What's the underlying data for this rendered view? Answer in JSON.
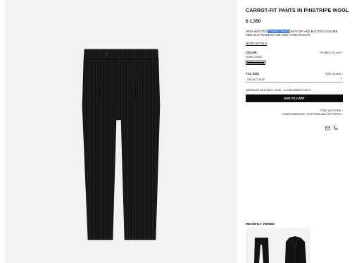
{
  "product": {
    "title": "CARROT-FIT PANTS IN PINSTRIPE WOOL",
    "price": "$ 1,350",
    "description_before": "HIGH-WAISTED ",
    "description_highlight": "CARROT PANTS",
    "description_after": " WITH ZIP AND BUTTON CLOSURE, SIDE SLIT POCKETS AND TWO FRONT PLEATS",
    "more_details": "MORE DETAILS"
  },
  "color": {
    "label": "COLOR:",
    "value": "NOIR CRAIE",
    "other_styles": "OTHER STYLES",
    "swatch_color": "#000000"
  },
  "size": {
    "label": "YSL SIZE",
    "guide": "SIZE GUIDE",
    "placeholder": "SELECT SIZE"
  },
  "delivery": "AVERAGE DELIVERY TIME : 3-8 BUSINESS DAYS",
  "add_to_cart": "ADD TO CART",
  "links": {
    "find_in_store": "FIND IN STORE",
    "complimentary": "COMPLIMENTARY SHIPPING AND RETURNS"
  },
  "icons": {
    "chevron": "›",
    "email": "mail-icon",
    "phone": "phone-icon"
  },
  "recently_viewed": {
    "label": "RECENTLY VIEWED"
  },
  "colors": {
    "button": "#0b0b0b",
    "highlight": "#2f6fdd",
    "image_bg": "#f2f2f2"
  }
}
